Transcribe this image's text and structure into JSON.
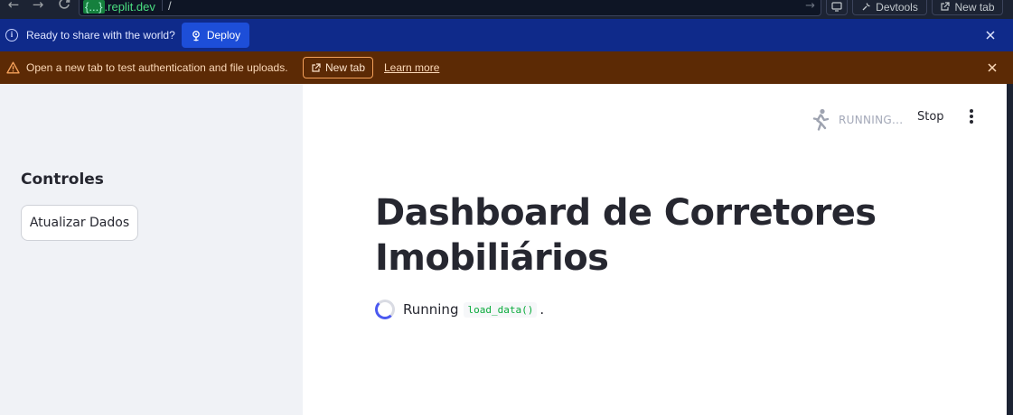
{
  "browser": {
    "url_host_masked": "{...}",
    "url_host_rest": ".replit.dev",
    "url_path": "/",
    "devtools_label": "Devtools",
    "new_tab_label": "New tab"
  },
  "deploy_banner": {
    "message": "Ready to share with the world?",
    "button_label": "Deploy"
  },
  "warning_banner": {
    "message": "Open a new tab to test authentication and file uploads.",
    "new_tab_label": "New tab",
    "learn_more_label": "Learn more"
  },
  "app": {
    "status_label": "RUNNING...",
    "stop_label": "Stop",
    "sidebar": {
      "heading": "Controles",
      "refresh_button": "Atualizar Dados"
    },
    "title_line1": "Dashboard de Corretores",
    "title_line2": "Imobiliários",
    "running_prefix": "Running",
    "running_code": "load_data()",
    "running_suffix": "."
  },
  "colors": {
    "deploy_banner_bg": "#0f2a8a",
    "warning_banner_bg": "#5c2a05",
    "sidebar_bg": "#f0f2f6",
    "accent_spinner": "#4b59f0",
    "code_text": "#09ab3b"
  },
  "icons": {
    "back": "arrow-left-icon",
    "forward": "arrow-right-icon",
    "reload": "reload-icon",
    "info": "info-icon",
    "deploy": "deploy-icon",
    "warning": "warning-triangle-icon",
    "external": "external-link-icon",
    "running": "running-figure-icon",
    "menu": "kebab-menu-icon"
  }
}
